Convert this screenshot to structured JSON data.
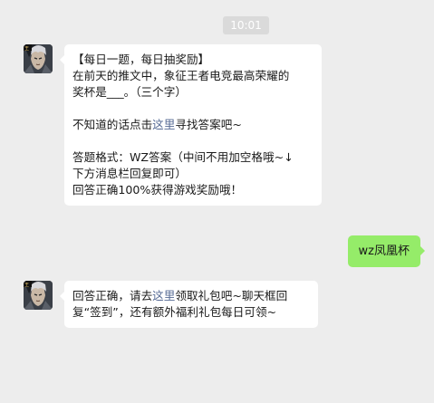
{
  "chat": {
    "timestamp": "10:01",
    "msg1": {
      "title": "【每日一题，每日抽奖励】",
      "q_line1": "在前天的推文中，象征王者电竞最高荣耀的",
      "q_line2": "奖杯是___。（三个字）",
      "hint_before": "不知道的话点击",
      "hint_link": "这里",
      "hint_after": "寻找答案吧~",
      "fmt_line1": "答题格式：WZ答案（中间不用加空格哦~↓",
      "fmt_line2": "下方消息栏回复即可）",
      "reward": "回答正确100%获得游戏奖励哦！"
    },
    "user_reply": "wz凤凰杯",
    "msg2": {
      "line1_before": "回答正确，请去",
      "line1_link": "这里",
      "line1_after": "领取礼包吧~聊天框回",
      "line2": "复“签到”，还有额外福利礼包每日可领~"
    }
  }
}
